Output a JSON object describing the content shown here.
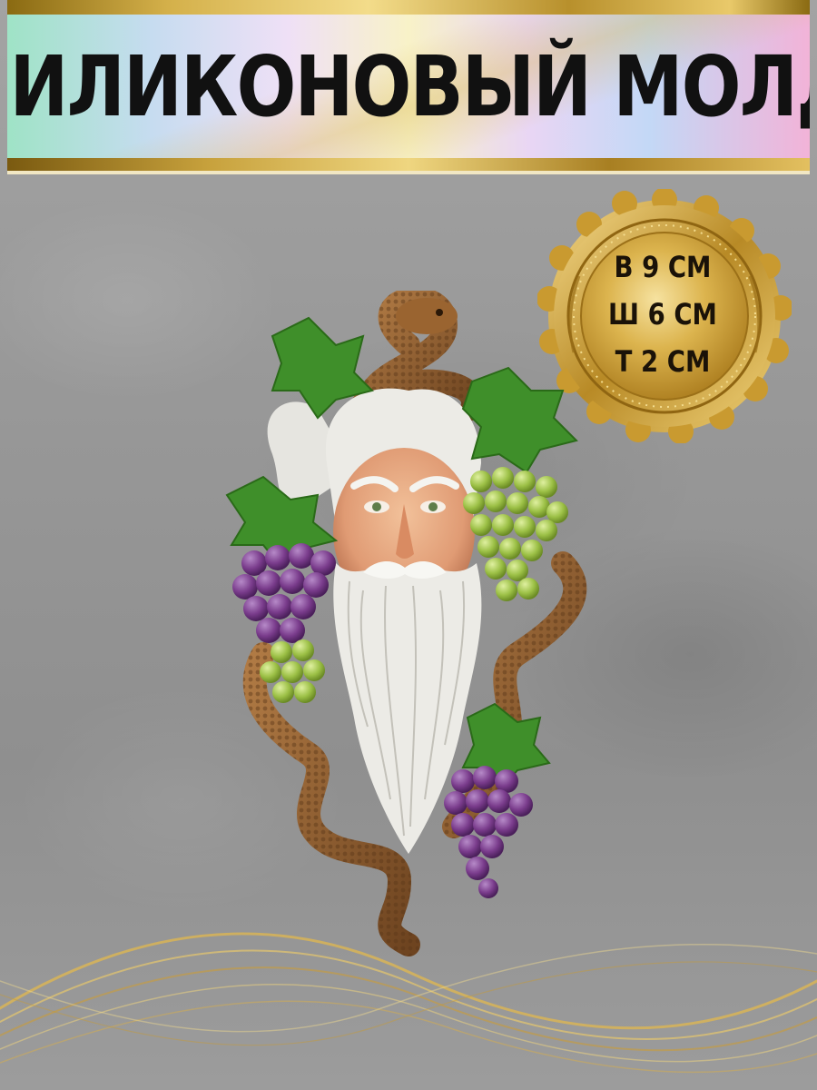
{
  "banner": {
    "title": "СИЛИКОНОВЫЙ МОЛД"
  },
  "badge": {
    "icon": "gold-seal-icon",
    "lines": [
      "В 9 СМ",
      "Ш 6 СМ",
      "Т 2 СМ"
    ]
  },
  "product": {
    "image": "bearded-face-grapes-snake-mold-illustration"
  },
  "colors": {
    "background": "#979797",
    "gold": "#d4a93a",
    "title_text": "#111111",
    "grape_purple": "#7a3c8c",
    "grape_green": "#9cc046",
    "leaf_green": "#3f8f2a",
    "snake_brown": "#8a5a2c",
    "beard_white": "#ecebe6"
  }
}
